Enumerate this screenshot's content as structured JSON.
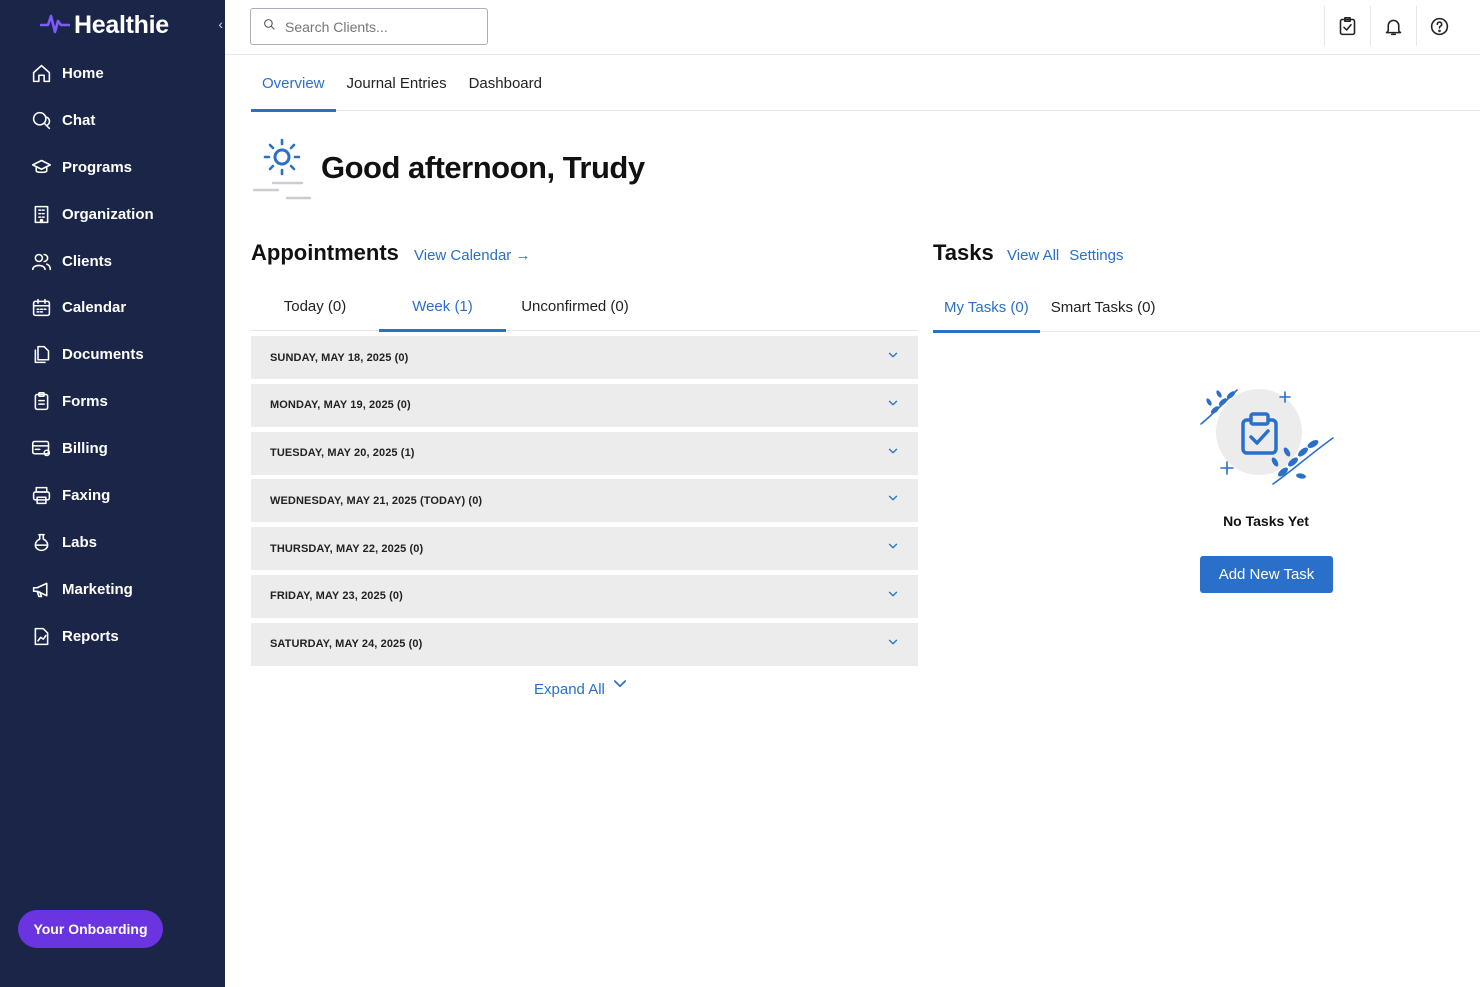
{
  "brand": {
    "name": "Healthie",
    "icon": "pulse-logo-icon"
  },
  "sidebar": {
    "collapse_icon": "chevron-left-icon",
    "items": [
      {
        "label": "Home",
        "icon": "home-icon"
      },
      {
        "label": "Chat",
        "icon": "chat-icon"
      },
      {
        "label": "Programs",
        "icon": "graduation-cap-icon"
      },
      {
        "label": "Organization",
        "icon": "building-icon"
      },
      {
        "label": "Clients",
        "icon": "users-icon"
      },
      {
        "label": "Calendar",
        "icon": "calendar-icon"
      },
      {
        "label": "Documents",
        "icon": "documents-icon"
      },
      {
        "label": "Forms",
        "icon": "clipboard-icon"
      },
      {
        "label": "Billing",
        "icon": "billing-icon"
      },
      {
        "label": "Faxing",
        "icon": "printer-icon"
      },
      {
        "label": "Labs",
        "icon": "flask-icon"
      },
      {
        "label": "Marketing",
        "icon": "megaphone-icon"
      },
      {
        "label": "Reports",
        "icon": "report-icon"
      }
    ],
    "onboarding_label": "Your Onboarding"
  },
  "topbar": {
    "search_placeholder": "Search Clients...",
    "icons": [
      "task-check-icon",
      "bell-icon",
      "help-icon"
    ]
  },
  "tabs": [
    {
      "label": "Overview",
      "active": true
    },
    {
      "label": "Journal Entries",
      "active": false
    },
    {
      "label": "Dashboard",
      "active": false
    }
  ],
  "greeting": "Good afternoon, Trudy",
  "appointments": {
    "title": "Appointments",
    "view_calendar": "View Calendar →",
    "tabs": [
      {
        "label": "Today (0)",
        "active": false
      },
      {
        "label": "Week (1)",
        "active": true
      },
      {
        "label": "Unconfirmed (0)",
        "active": false
      }
    ],
    "days": [
      "SUNDAY, MAY 18, 2025 (0)",
      "MONDAY, MAY 19, 2025 (0)",
      "TUESDAY, MAY 20, 2025 (1)",
      "WEDNESDAY, MAY 21, 2025 (TODAY) (0)",
      "THURSDAY, MAY 22, 2025 (0)",
      "FRIDAY, MAY 23, 2025 (0)",
      "SATURDAY, MAY 24, 2025 (0)"
    ],
    "expand_all": "Expand All"
  },
  "tasks": {
    "title": "Tasks",
    "view_all": "View All",
    "settings": "Settings",
    "tabs": [
      {
        "label": "My Tasks (0)",
        "active": true
      },
      {
        "label": "Smart Tasks (0)",
        "active": false
      }
    ],
    "empty_text": "No Tasks Yet",
    "add_button": "Add New Task"
  },
  "colors": {
    "sidebar_bg": "#1a2547",
    "accent": "#2a6fc9",
    "onboarding": "#6a35e0",
    "row_bg": "#ececec"
  }
}
